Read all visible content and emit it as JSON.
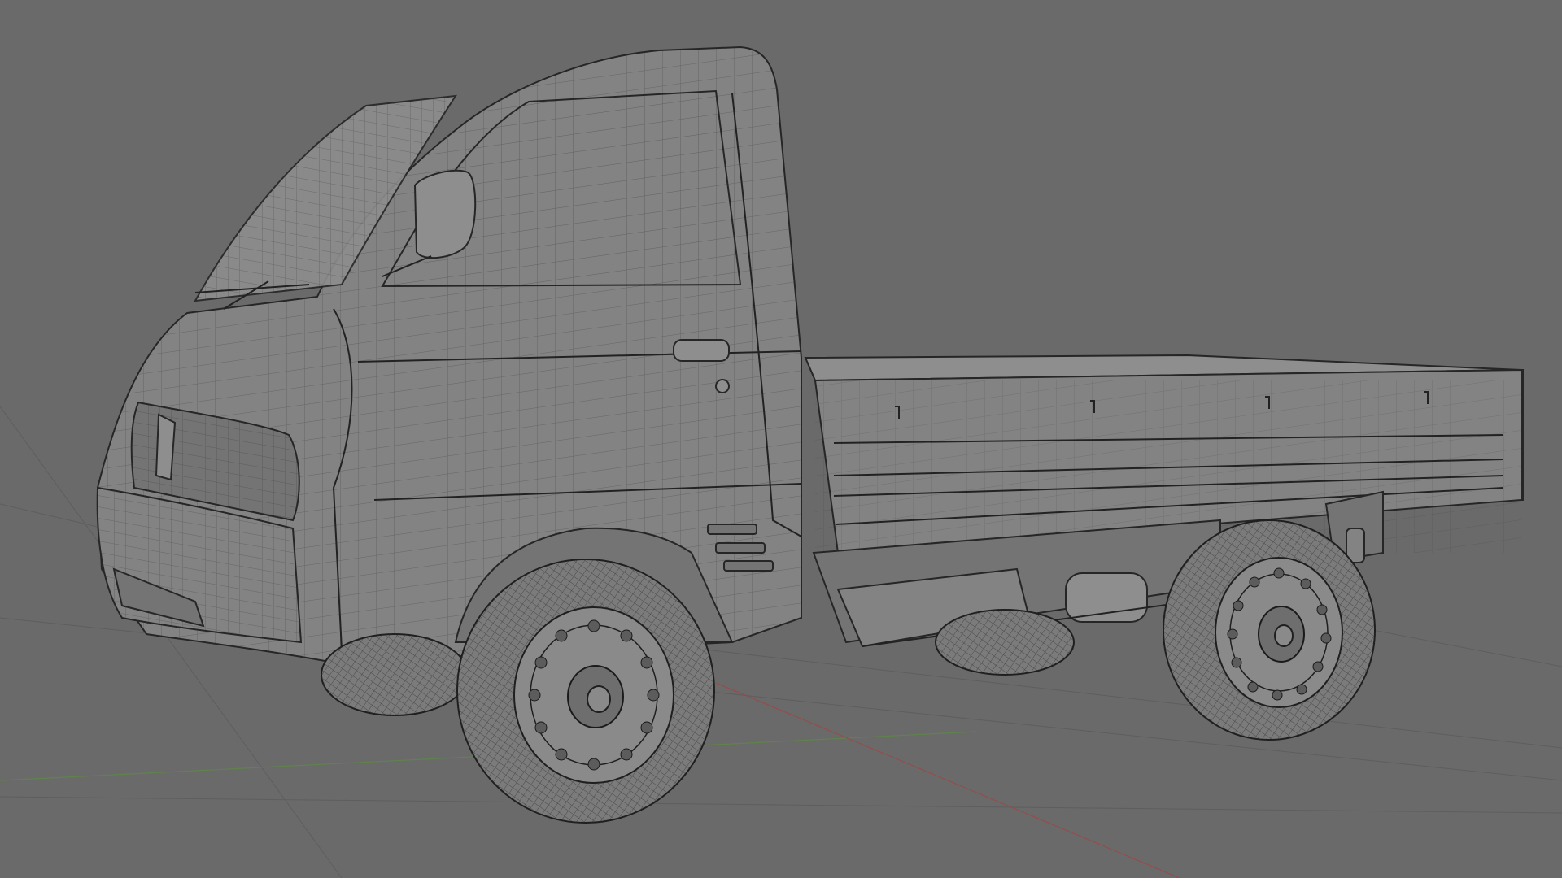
{
  "viewport": {
    "background_color": "#6a6a6a",
    "model_color": "#838383",
    "wire_color": "#2a2a2a",
    "axis_x_color": "#a04545",
    "axis_y_color": "#5e8a44"
  },
  "scene": {
    "object": "pickup-truck-wireframe-model",
    "shading": "solid-with-wireframe-overlay"
  }
}
